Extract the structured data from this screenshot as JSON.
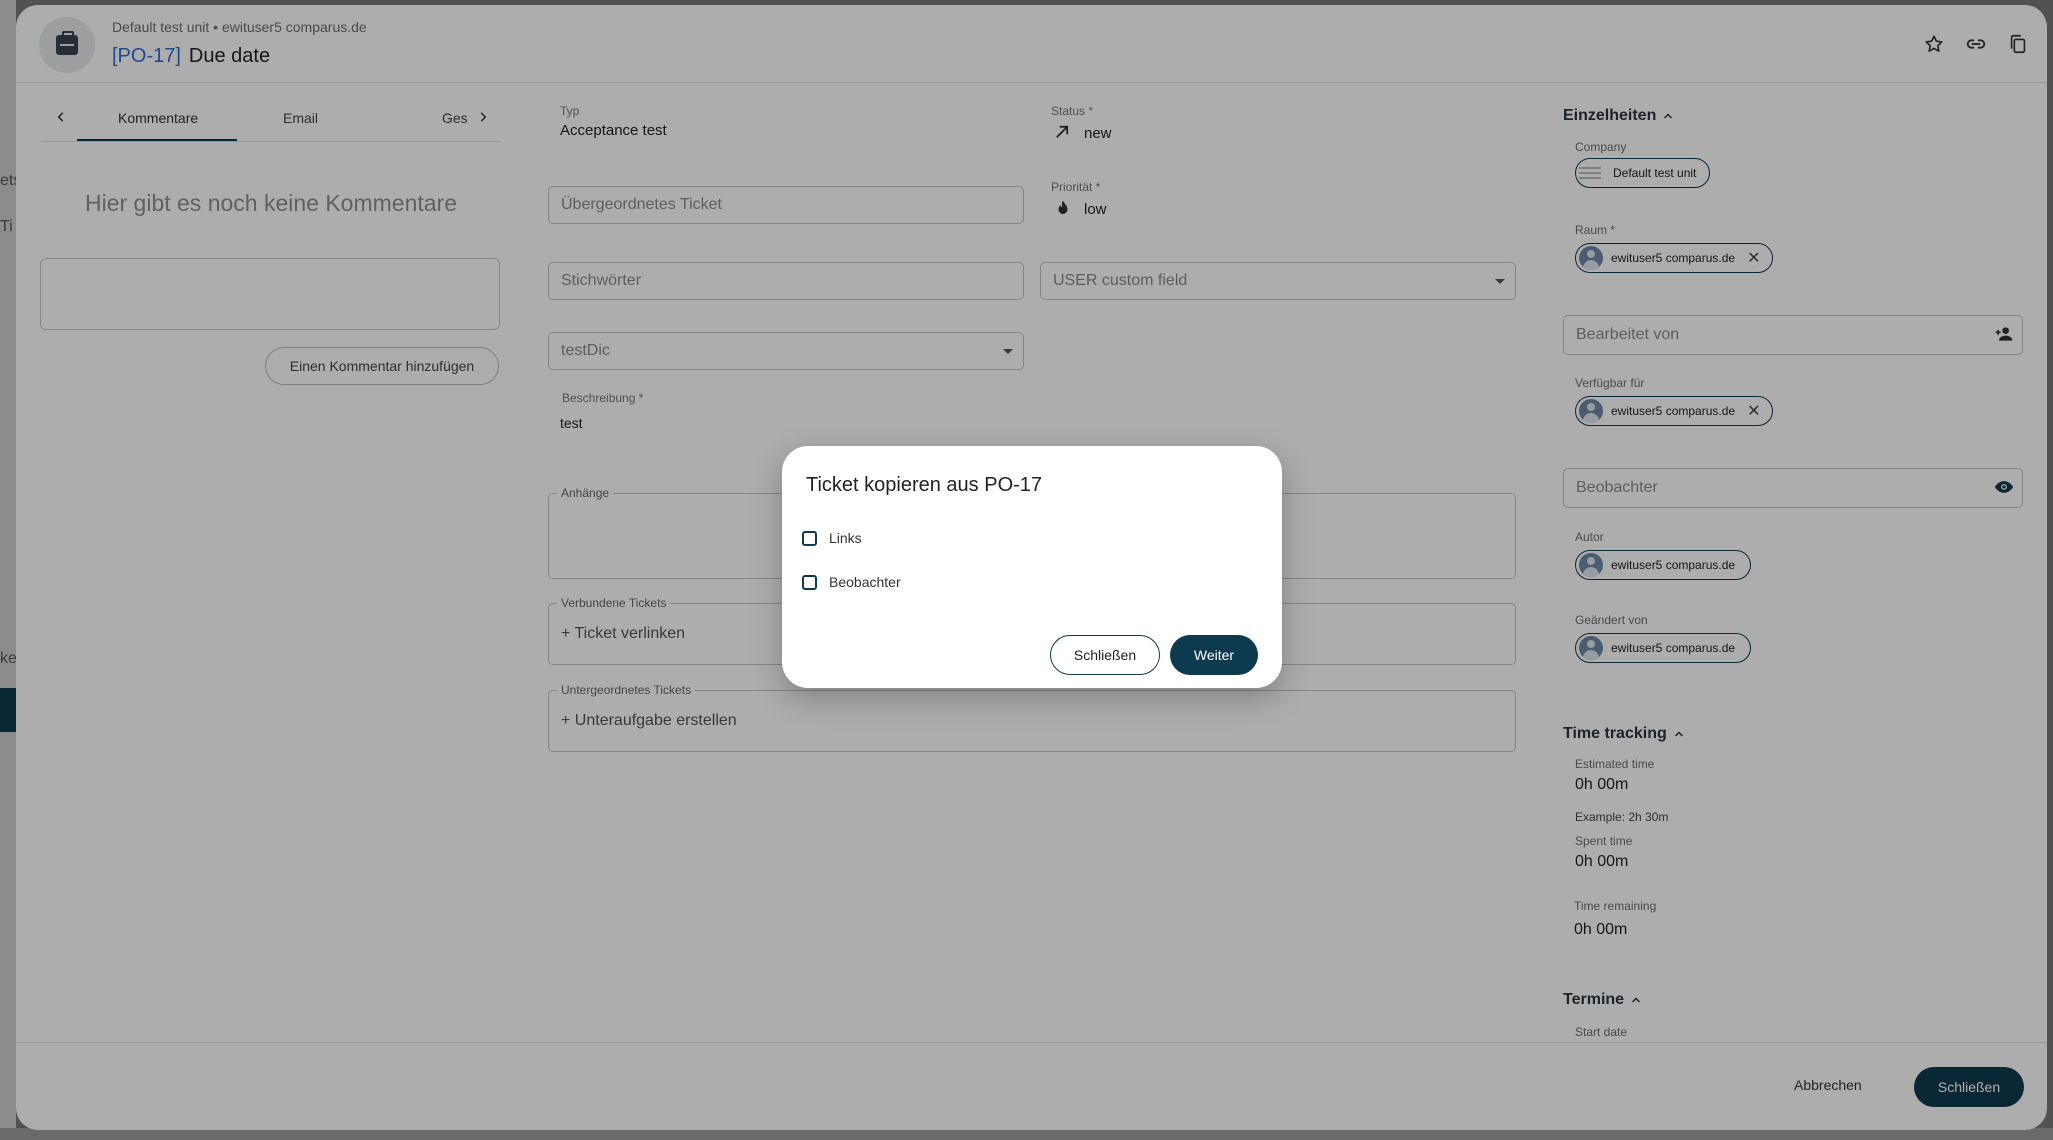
{
  "background": {
    "frag1": "ets",
    "frag2": "Ti",
    "frag3": "ke"
  },
  "header": {
    "breadcrumb": "Default test unit • ewituser5 comparus.de",
    "ticket_key": "[PO-17]",
    "ticket_title": "Due date",
    "icons": [
      "star-icon",
      "link-icon",
      "copy-icon"
    ]
  },
  "left_panel": {
    "tabs": [
      "Kommentare",
      "Email",
      "Ges"
    ],
    "empty_text": "Hier gibt es noch keine Kommentare",
    "add_comment_label": "Einen Kommentar hinzufügen"
  },
  "main": {
    "typ_label": "Typ",
    "typ_value": "Acceptance test",
    "status_label": "Status *",
    "status_value": "new",
    "priority_label": "Priorität *",
    "priority_value": "low",
    "parent_ticket_placeholder": "Übergeordnetes Ticket",
    "keywords_placeholder": "Stichwörter",
    "user_field_placeholder": "USER custom field",
    "testdic_placeholder": "testDic",
    "description_label": "Beschreibung *",
    "description_value": "test",
    "attachments_legend": "Anhänge",
    "linked_legend": "Verbundene Tickets",
    "link_ticket_action": "+ Ticket verlinken",
    "subtickets_legend": "Untergeordnetes Tickets",
    "create_subtask_action": "+ Unteraufgabe erstellen"
  },
  "right_panel": {
    "details_title": "Einzelheiten",
    "company_label": "Company",
    "company_value": "Default test unit",
    "room_label": "Raum *",
    "user_chip": "ewituser5 comparus.de",
    "edited_by_placeholder": "Bearbeitet von",
    "available_for_label": "Verfügbar für",
    "watchers_placeholder": "Beobachter",
    "author_label": "Autor",
    "changed_by_label": "Geändert von",
    "time_tracking_title": "Time tracking",
    "estimated_label": "Estimated time",
    "estimated_value": "0h 00m",
    "example_hint": "Example: 2h 30m",
    "spent_label": "Spent time",
    "spent_value": "0h 00m",
    "remaining_label": "Time remaining",
    "remaining_value": "0h 00m",
    "dates_title": "Termine",
    "start_date_label": "Start date"
  },
  "footer": {
    "cancel_label": "Abbrechen",
    "close_label": "Schließen"
  },
  "dialog": {
    "title": "Ticket kopieren aus PO-17",
    "options": [
      "Links",
      "Beobachter"
    ],
    "close_label": "Schließen",
    "next_label": "Weiter"
  },
  "colors": {
    "primary": "#0e3a4f",
    "link_blue": "#2a6fd6"
  }
}
